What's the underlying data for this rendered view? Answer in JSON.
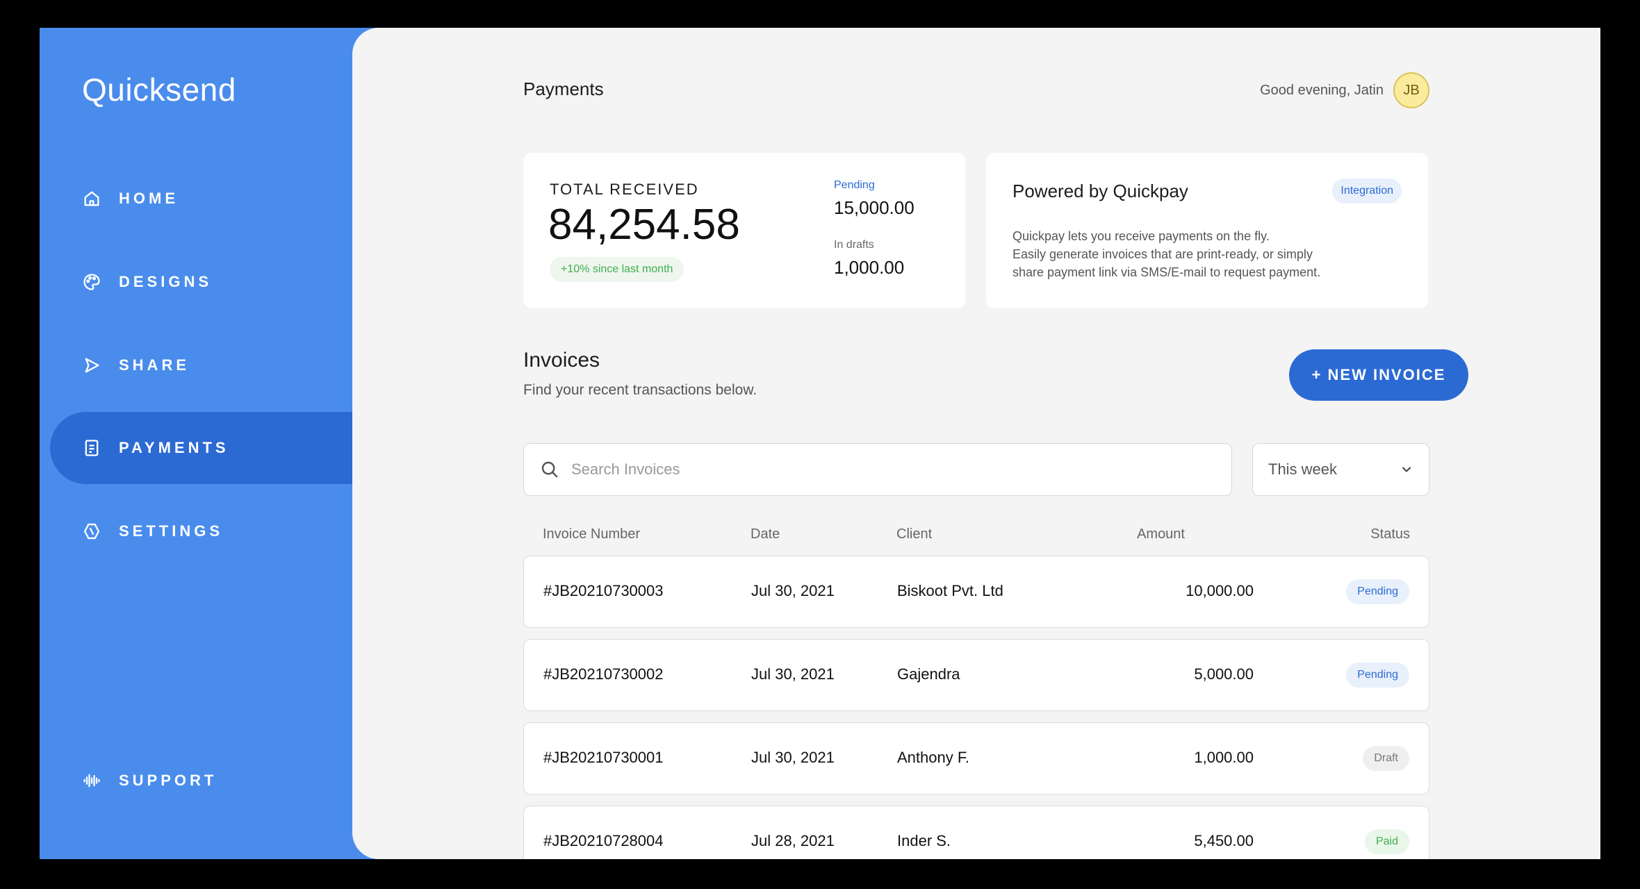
{
  "app": {
    "name": "Quicksend"
  },
  "sidebar": {
    "items": [
      {
        "label": "HOME",
        "icon": "home-icon"
      },
      {
        "label": "DESIGNS",
        "icon": "palette-icon"
      },
      {
        "label": "SHARE",
        "icon": "send-icon"
      },
      {
        "label": "PAYMENTS",
        "icon": "document-icon",
        "active": true
      },
      {
        "label": "SETTINGS",
        "icon": "settings-icon"
      }
    ],
    "support": {
      "label": "SUPPORT",
      "icon": "audio-wave-icon"
    }
  },
  "header": {
    "title": "Payments",
    "greeting": "Good evening, Jatin",
    "avatar_initials": "JB"
  },
  "summary": {
    "total_label": "TOTAL RECEIVED",
    "total_value": "84,254.58",
    "growth": "+10% since last month",
    "pending_label": "Pending",
    "pending_value": "15,000.00",
    "drafts_label": "In drafts",
    "drafts_value": "1,000.00"
  },
  "promo": {
    "title": "Powered by Quickpay",
    "badge": "Integration",
    "lines": [
      "Quickpay lets you receive payments on the fly.",
      "Easily generate invoices that are print-ready, or simply",
      "share payment link via SMS/E-mail to request payment."
    ]
  },
  "invoices": {
    "title": "Invoices",
    "subtitle": "Find your recent transactions below.",
    "new_button": "+ NEW INVOICE",
    "search_placeholder": "Search Invoices",
    "filter_value": "This week",
    "columns": [
      "Invoice Number",
      "Date",
      "Client",
      "Amount",
      "Status"
    ],
    "rows": [
      {
        "number": "#JB20210730003",
        "date": "Jul 30, 2021",
        "client": "Biskoot Pvt. Ltd",
        "amount": "10,000.00",
        "status": "Pending"
      },
      {
        "number": "#JB20210730002",
        "date": "Jul 30, 2021",
        "client": "Gajendra",
        "amount": "5,000.00",
        "status": "Pending"
      },
      {
        "number": "#JB20210730001",
        "date": "Jul 30, 2021",
        "client": "Anthony F.",
        "amount": "1,000.00",
        "status": "Draft"
      },
      {
        "number": "#JB20210728004",
        "date": "Jul 28, 2021",
        "client": "Inder S.",
        "amount": "5,450.00",
        "status": "Paid"
      }
    ]
  },
  "colors": {
    "sidebar": "#4a8cec",
    "accent": "#2c6ad3",
    "pending": "#2c6ad3",
    "paid": "#3fae4e",
    "draft": "#777777"
  }
}
